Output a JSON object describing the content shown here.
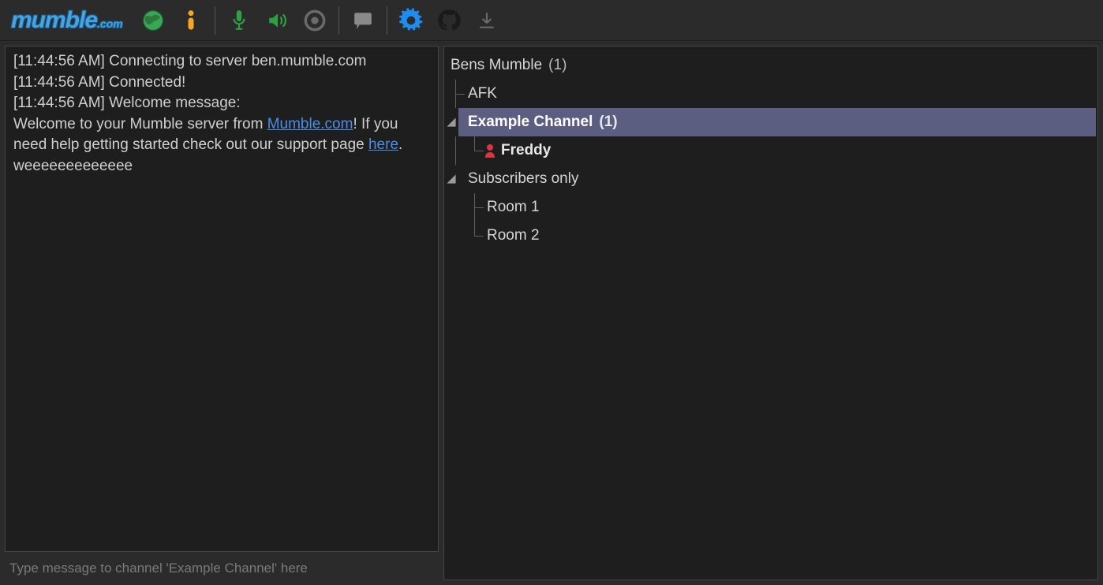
{
  "logo": {
    "text": "mumble",
    "suffix": ".com"
  },
  "toolbar_icons": {
    "globe": "globe-icon",
    "info": "info-icon",
    "mic": "microphone-icon",
    "speaker": "speaker-icon",
    "record": "record-icon",
    "chat": "chat-icon",
    "settings": "settings-gear-icon",
    "github": "github-icon",
    "download": "download-icon"
  },
  "log": {
    "line1_ts": "[11:44:56 AM] ",
    "line1_msg": "Connecting to server ben.mumble.com",
    "line2_ts": "[11:44:56 AM] ",
    "line2_msg": "Connected!",
    "line3_ts": "[11:44:56 AM] ",
    "line3_msg": "Welcome message:",
    "welcome_pre": "Welcome to your Mumble server from ",
    "welcome_link1": "Mumble.com",
    "welcome_mid1": "! If you need help getting started check out our support page ",
    "welcome_link2": "here",
    "welcome_mid2": ".       ",
    "welcome_tail": "weeeeeeeeeeeee"
  },
  "chat_placeholder": "Type message to channel 'Example Channel' here",
  "tree": {
    "root": {
      "label": "Bens Mumble",
      "count": "(1)"
    },
    "afk": {
      "label": "AFK"
    },
    "example": {
      "label": "Example Channel",
      "count": "(1)"
    },
    "user1": {
      "name": "Freddy"
    },
    "subs": {
      "label": "Subscribers only"
    },
    "room1": {
      "label": "Room 1"
    },
    "room2": {
      "label": "Room 2"
    }
  }
}
